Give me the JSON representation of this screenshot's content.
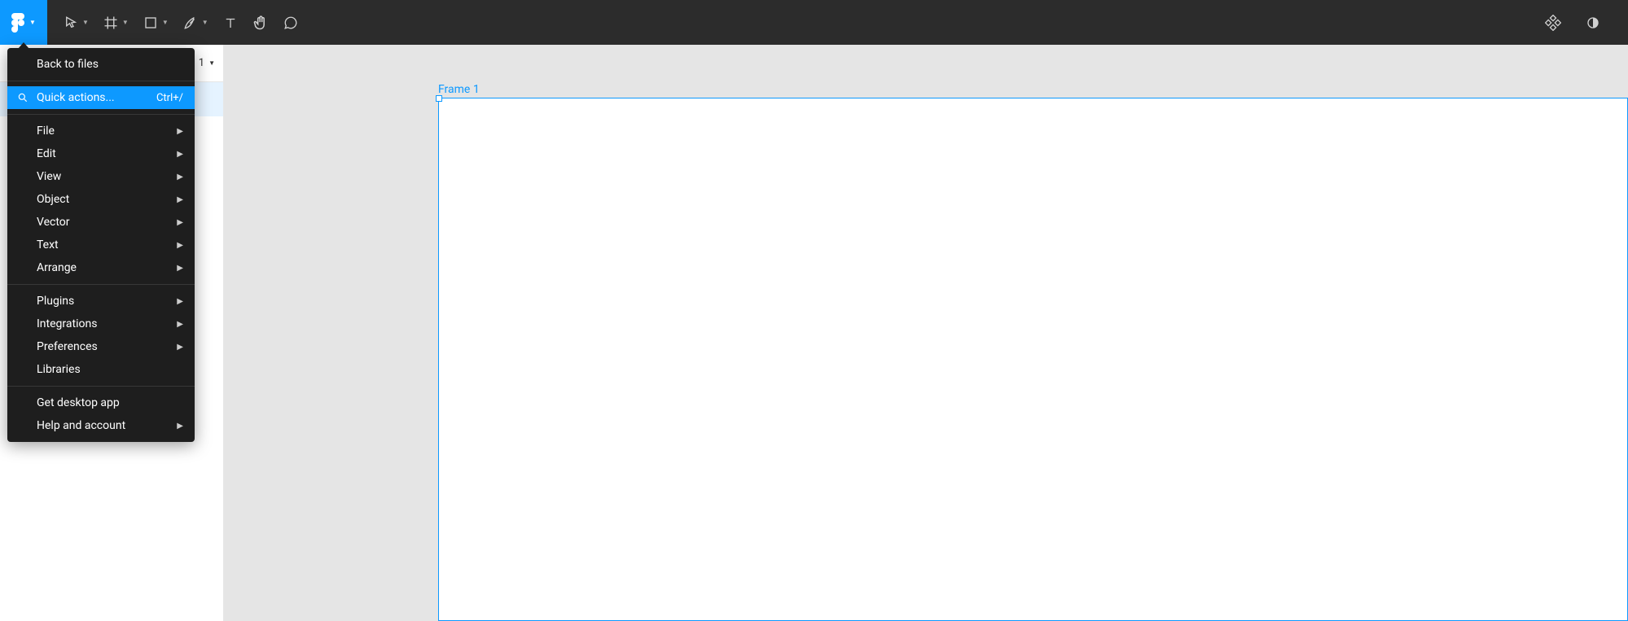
{
  "toolbar": {},
  "menu": {
    "back": "Back to files",
    "quick_actions": {
      "label": "Quick actions...",
      "shortcut": "Ctrl+/"
    },
    "file": "File",
    "edit": "Edit",
    "view": "View",
    "object": "Object",
    "vector": "Vector",
    "text": "Text",
    "arrange": "Arrange",
    "plugins": "Plugins",
    "integrations": "Integrations",
    "preferences": "Preferences",
    "libraries": "Libraries",
    "desktop": "Get desktop app",
    "help": "Help and account"
  },
  "left_panel": {
    "truncated_item": "1"
  },
  "canvas": {
    "frame_label": "Frame 1"
  }
}
